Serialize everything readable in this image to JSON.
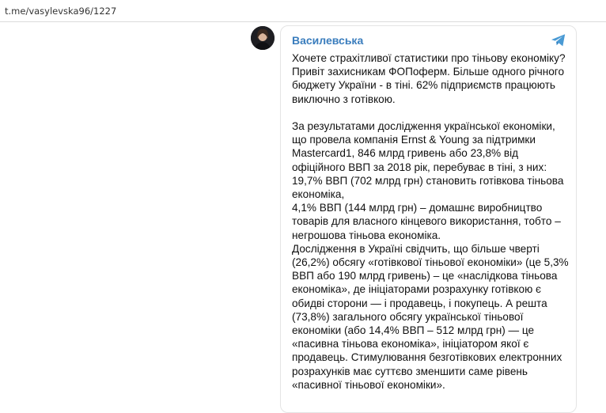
{
  "browser": {
    "url": "t.me/vasylevska96/1227"
  },
  "post": {
    "channel_name": "Василевська",
    "avatar_icon": "channel-avatar",
    "platform_icon": "telegram-paper-plane-icon",
    "accent_color": "#3a7dbd",
    "paragraphs": [
      "Хочете страхітливої статистики про тіньову економіку? Привіт захисникам ФОПоферм. Більше одного річного бюджету України - в тіні. 62% підприємств працюють виключно з готівкою.",
      "",
      "За результатами дослідження української економіки, що провела компанія Ernst & Young за підтримки Mastercard1, 846 млрд гривень або 23,8% від офіційного ВВП за 2018 рік, перебуває в тіні, з них: 19,7% ВВП (702 млрд грн) становить готівкова тіньова економіка,",
      "4,1% ВВП (144 млрд грн) – домашнє виробництво товарів для власного кінцевого використання, тобто – негрошова тіньова економіка.",
      "Дослідження в Україні свідчить, що більше чверті (26,2%) обсягу «готівкової тіньової економіки» (це 5,3% ВВП або 190 млрд гривень) – це «наслідкова тіньова економіка», де ініціаторами розрахунку готівкою є обидві сторони — і продавець, і покупець. А решта (73,8%) загального обсягу української тіньової економіки (або 14,4% ВВП – 512 млрд грн) — це «пасивна тіньова економіка», ініціатором якої є продавець. Стимулювання безготівкових електронних розрахунків має суттєво зменшити саме рівень «пасивної тіньової економіки»."
    ]
  }
}
